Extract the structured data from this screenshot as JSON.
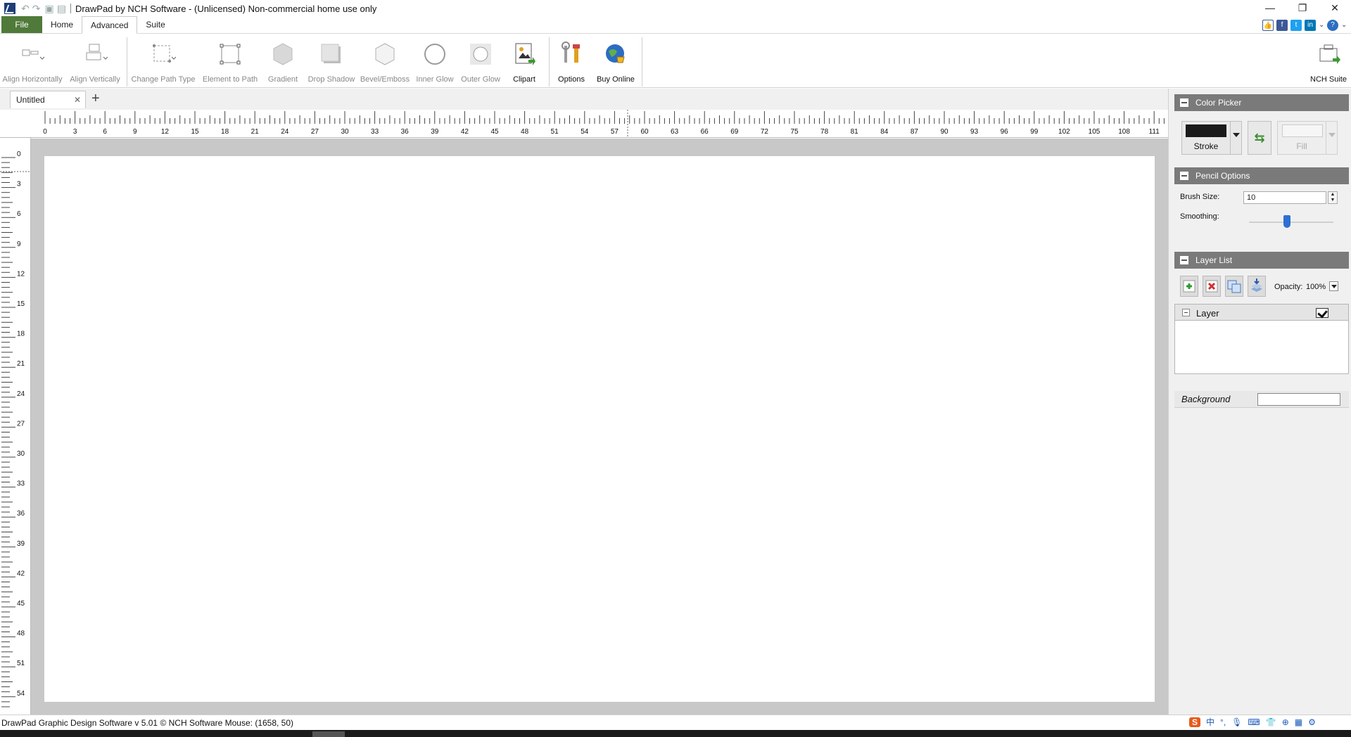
{
  "window": {
    "title": "DrawPad by NCH Software - (Unlicensed) Non-commercial home use only",
    "controls": [
      "—",
      "❐",
      "✕"
    ]
  },
  "menu": {
    "tabs": [
      "File",
      "Home",
      "Advanced",
      "Suite"
    ]
  },
  "ribbon": {
    "align_horizontally": "Align Horizontally",
    "align_vertically": "Align Vertically",
    "change_path_type": "Change Path Type",
    "element_to_path": "Element to Path",
    "gradient": "Gradient",
    "drop_shadow": "Drop Shadow",
    "bevel_emboss": "Bevel/Emboss",
    "inner_glow": "Inner Glow",
    "outer_glow": "Outer Glow",
    "clipart": "Clipart",
    "options": "Options",
    "buy_online": "Buy Online",
    "nch_suite": "NCH Suite"
  },
  "document": {
    "tab_name": "Untitled",
    "close_glyph": "✕",
    "add_glyph": "+"
  },
  "rulers": {
    "horizontal_labels": [
      "0",
      "3",
      "6",
      "9",
      "12",
      "15",
      "18",
      "21",
      "24",
      "27",
      "30",
      "33",
      "36",
      "39",
      "42",
      "45",
      "48",
      "51",
      "54",
      "57",
      "60",
      "63",
      "66",
      "69",
      "72",
      "75",
      "78",
      "81",
      "84",
      "87",
      "90",
      "93",
      "96",
      "99",
      "102",
      "105",
      "108",
      "111"
    ],
    "vertical_labels": [
      "0",
      "3",
      "6",
      "9",
      "12",
      "15",
      "18",
      "21",
      "24",
      "27",
      "30",
      "33",
      "36",
      "39",
      "42",
      "45",
      "48",
      "51",
      "54"
    ]
  },
  "panels": {
    "color_picker": {
      "title": "Color Picker",
      "stroke_label": "Stroke",
      "fill_label": "Fill",
      "stroke_color": "#1a1a1a",
      "fill_color": "#f6f6f6"
    },
    "pencil_options": {
      "title": "Pencil Options",
      "brush_size_label": "Brush Size:",
      "brush_size_value": "10",
      "smoothing_label": "Smoothing:",
      "smoothing_level": 0.45
    },
    "layer_list": {
      "title": "Layer List",
      "opacity_label": "Opacity:",
      "opacity_value": "100%",
      "layer_name": "Layer",
      "background_label": "Background"
    }
  },
  "status": {
    "text": "DrawPad Graphic Design Software v 5.01 © NCH Softwar⁠e  Mouse: (1658, 50)"
  },
  "colors": {
    "file_tab": "#4f7a3a",
    "panel_header": "#7a7a7a",
    "canvas_bg": "#c8c8c8",
    "slider_thumb": "#2f6fd3"
  }
}
